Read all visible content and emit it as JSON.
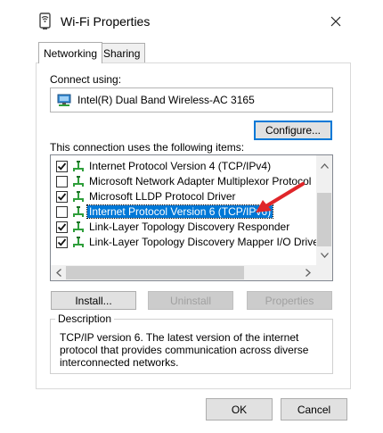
{
  "window": {
    "title": "Wi-Fi Properties"
  },
  "tabs": [
    {
      "label": "Networking",
      "active": true
    },
    {
      "label": "Sharing",
      "active": false
    }
  ],
  "connect_using": {
    "label": "Connect using:",
    "adapter": "Intel(R) Dual Band Wireless-AC 3165",
    "configure_label": "Configure..."
  },
  "items_label": "This connection uses the following items:",
  "items": [
    {
      "label": "Internet Protocol Version 4 (TCP/IPv4)",
      "checked": true,
      "selected": false
    },
    {
      "label": "Microsoft Network Adapter Multiplexor Protocol",
      "checked": false,
      "selected": false
    },
    {
      "label": "Microsoft LLDP Protocol Driver",
      "checked": true,
      "selected": false
    },
    {
      "label": "Internet Protocol Version 6 (TCP/IPv6)",
      "checked": false,
      "selected": true
    },
    {
      "label": "Link-Layer Topology Discovery Responder",
      "checked": true,
      "selected": false
    },
    {
      "label": "Link-Layer Topology Discovery Mapper I/O Driver",
      "checked": true,
      "selected": false
    }
  ],
  "actions": {
    "install": "Install...",
    "uninstall": "Uninstall",
    "properties": "Properties"
  },
  "description": {
    "legend": "Description",
    "text": "TCP/IP version 6. The latest version of the internet protocol that provides communication across diverse interconnected networks."
  },
  "footer": {
    "ok": "OK",
    "cancel": "Cancel"
  },
  "colors": {
    "accent": "#0078d7",
    "annotation_arrow": "#e0262a",
    "item_icon": "#2e9e3a"
  }
}
